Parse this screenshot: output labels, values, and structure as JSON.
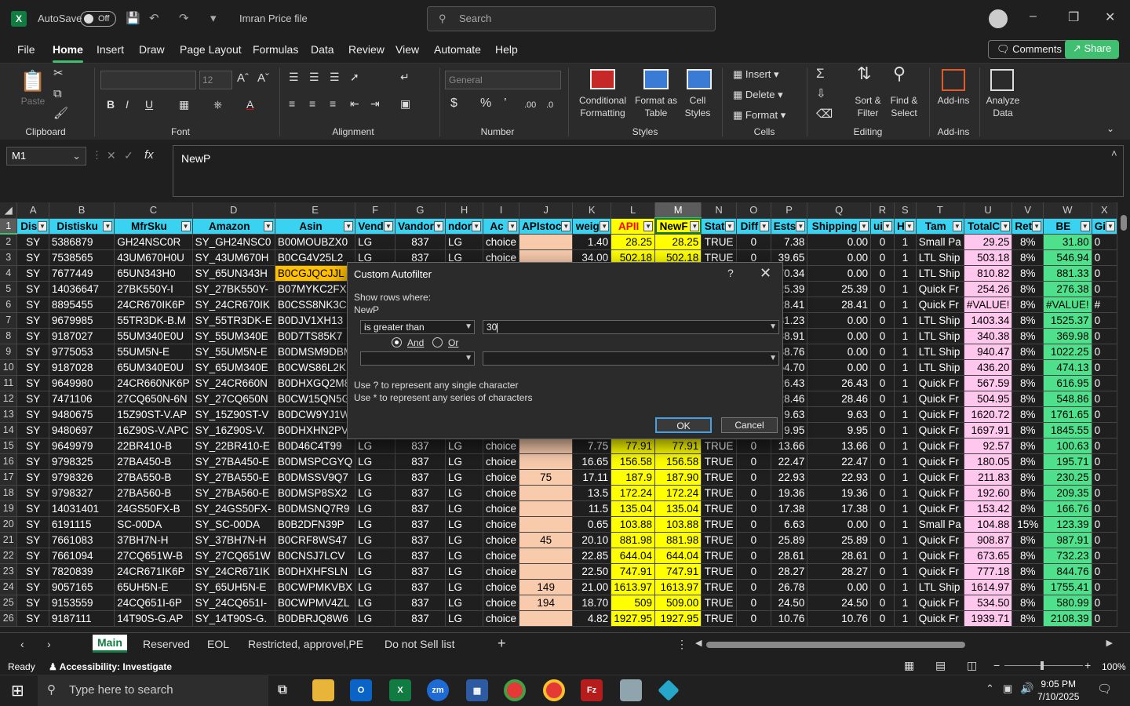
{
  "titlebar": {
    "autosave_label": "AutoSave",
    "autosave_state": "Off",
    "filename": "Imran Price file",
    "search_placeholder": "Search"
  },
  "menu": [
    "File",
    "Home",
    "Insert",
    "Draw",
    "Page Layout",
    "Formulas",
    "Data",
    "Review",
    "View",
    "Automate",
    "Help"
  ],
  "active_menu": "Home",
  "comments_label": "Comments",
  "share_label": "Share",
  "ribbon": {
    "paste": "Paste",
    "clipboard": "Clipboard",
    "font_group": "Font",
    "font_size": "12",
    "alignment": "Alignment",
    "number_format": "General",
    "number": "Number",
    "cond_fmt": "Conditional Formatting",
    "format_table": "Format as Table",
    "cell_styles": "Cell Styles",
    "styles": "Styles",
    "insert": "Insert",
    "delete": "Delete",
    "format": "Format",
    "cells": "Cells",
    "sort_filter": "Sort & Filter",
    "find_select": "Find & Select",
    "editing": "Editing",
    "addins_btn": "Add-ins",
    "addins": "Add-ins",
    "analyze": "Analyze Data"
  },
  "formula_bar": {
    "name_box": "M1",
    "content": "NewP"
  },
  "columns": [
    "A",
    "B",
    "C",
    "D",
    "E",
    "F",
    "G",
    "H",
    "I",
    "J",
    "K",
    "L",
    "M",
    "N",
    "O",
    "P",
    "Q",
    "R",
    "S",
    "T",
    "U",
    "V",
    "W",
    "X"
  ],
  "headers": [
    "Dis",
    "Distisku",
    "MfrSku",
    "Amazon",
    "Asin",
    "Vend",
    "Vandor",
    "ndor",
    "Ac",
    "APIstoc",
    "weig",
    "APII",
    "NewF",
    "Stat",
    "Diff",
    "Ests",
    "Shipping",
    "ui",
    "H",
    "Tam",
    "TotalC",
    "Ret",
    "BE",
    "Gi"
  ],
  "rows": [
    {
      "n": "2",
      "c": [
        "SY",
        "5386879",
        "GH24NSC0R",
        "SY_GH24NSC0",
        "B00MOUBZX0",
        "LG",
        "837",
        "LG",
        "choice",
        "",
        "1.40",
        "28.25",
        "28.25",
        "TRUE",
        "0",
        "7.38",
        "0.00",
        "0",
        "1",
        "Small Pa",
        "29.25",
        "8%",
        "31.80",
        "0"
      ]
    },
    {
      "n": "3",
      "c": [
        "SY",
        "7538565",
        "43UM670H0U",
        "SY_43UM670H",
        "B0CG4V25L2",
        "LG",
        "837",
        "LG",
        "choice",
        "",
        "34.00",
        "502.18",
        "502.18",
        "TRUE",
        "0",
        "39.65",
        "0.00",
        "0",
        "1",
        "LTL Ship",
        "503.18",
        "8%",
        "546.94",
        "0"
      ]
    },
    {
      "n": "4",
      "c": [
        "SY",
        "7677449",
        "65UN343H0",
        "SY_65UN343H",
        "B0CGJQCJJL",
        "LG",
        "837",
        "LG",
        "choice",
        "",
        "",
        "",
        "",
        "",
        "",
        "70.34",
        "0.00",
        "0",
        "1",
        "LTL Ship",
        "810.82",
        "8%",
        "881.33",
        "0"
      ]
    },
    {
      "n": "5",
      "c": [
        "SY",
        "14036647",
        "27BK550Y-I",
        "SY_27BK550Y-",
        "B07MYKC2FX",
        "LG",
        "837",
        "LG",
        "choice",
        "",
        "",
        "",
        "",
        "",
        "",
        "25.39",
        "25.39",
        "0",
        "1",
        "Quick Fr",
        "254.26",
        "8%",
        "276.38",
        "0"
      ]
    },
    {
      "n": "6",
      "c": [
        "SY",
        "8895455",
        "24CR670IK6P",
        "SY_24CR670IK",
        "B0CSS8NK3C",
        "LG",
        "837",
        "LG",
        "choice",
        "",
        "",
        "",
        "",
        "",
        "",
        "28.41",
        "28.41",
        "0",
        "1",
        "Quick Fr",
        "#VALUE!",
        "8%",
        "#VALUE!",
        "#"
      ]
    },
    {
      "n": "7",
      "c": [
        "SY",
        "9679985",
        "55TR3DK-B.M",
        "SY_55TR3DK-E",
        "B0DJV1XH13",
        "LG",
        "837",
        "LG",
        "choice",
        "",
        "",
        "",
        "",
        "",
        "",
        "81.23",
        "0.00",
        "0",
        "1",
        "LTL Ship",
        "1403.34",
        "8%",
        "1525.37",
        "0"
      ]
    },
    {
      "n": "8",
      "c": [
        "SY",
        "9187027",
        "55UM340E0U",
        "SY_55UM340E",
        "B0D7TS85K7",
        "LG",
        "837",
        "LG",
        "choice",
        "",
        "",
        "",
        "",
        "",
        "",
        "38.91",
        "0.00",
        "0",
        "1",
        "LTL Ship",
        "340.38",
        "8%",
        "369.98",
        "0"
      ]
    },
    {
      "n": "9",
      "c": [
        "SY",
        "9775053",
        "55UM5N-E",
        "SY_55UM5N-E",
        "B0DMSM9DBM",
        "LG",
        "837",
        "LG",
        "choice",
        "",
        "",
        "",
        "",
        "",
        "",
        "38.76",
        "0.00",
        "0",
        "1",
        "LTL Ship",
        "940.47",
        "8%",
        "1022.25",
        "0"
      ]
    },
    {
      "n": "10",
      "c": [
        "SY",
        "9187028",
        "65UM340E0U",
        "SY_65UM340E",
        "B0CWS86L2K",
        "LG",
        "837",
        "LG",
        "choice",
        "",
        "",
        "",
        "",
        "",
        "",
        "54.70",
        "0.00",
        "0",
        "1",
        "LTL Ship",
        "436.20",
        "8%",
        "474.13",
        "0"
      ]
    },
    {
      "n": "11",
      "c": [
        "SY",
        "9649980",
        "24CR660NK6P",
        "SY_24CR660N",
        "B0DHXGQ2M8",
        "LG",
        "837",
        "LG",
        "choice",
        "",
        "",
        "",
        "",
        "",
        "",
        "26.43",
        "26.43",
        "0",
        "1",
        "Quick Fr",
        "567.59",
        "8%",
        "616.95",
        "0"
      ]
    },
    {
      "n": "12",
      "c": [
        "SY",
        "7471106",
        "27CQ650N-6N",
        "SY_27CQ650N",
        "B0CW15QN5G",
        "LG",
        "837",
        "LG",
        "choice",
        "",
        "",
        "",
        "",
        "",
        "",
        "28.46",
        "28.46",
        "0",
        "1",
        "Quick Fr",
        "504.95",
        "8%",
        "548.86",
        "0"
      ]
    },
    {
      "n": "13",
      "c": [
        "SY",
        "9480675",
        "15Z90ST-V.AP",
        "SY_15Z90ST-V",
        "B0DCW9YJ1W",
        "LG",
        "837",
        "LG",
        "choice",
        "",
        "",
        "",
        "",
        "",
        "",
        "9.63",
        "9.63",
        "0",
        "1",
        "Quick Fr",
        "1620.72",
        "8%",
        "1761.65",
        "0"
      ]
    },
    {
      "n": "14",
      "c": [
        "SY",
        "9480697",
        "16Z90S-V.APC",
        "SY_16Z90S-V.",
        "B0DHXHN2PV",
        "LG",
        "837",
        "LG",
        "choice",
        "",
        "",
        "",
        "",
        "",
        "",
        "9.95",
        "9.95",
        "0",
        "1",
        "Quick Fr",
        "1697.91",
        "8%",
        "1845.55",
        "0"
      ]
    },
    {
      "n": "15",
      "c": [
        "SY",
        "9649979",
        "22BR410-B",
        "SY_22BR410-E",
        "B0D46C4T99",
        "LG",
        "837",
        "LG",
        "choice",
        "",
        "7.75",
        "77.91",
        "77.91",
        "TRUE",
        "0",
        "13.66",
        "13.66",
        "0",
        "1",
        "Quick Fr",
        "92.57",
        "8%",
        "100.63",
        "0"
      ]
    },
    {
      "n": "16",
      "c": [
        "SY",
        "9798325",
        "27BA450-B",
        "SY_27BA450-E",
        "B0DMSPCGYQ",
        "LG",
        "837",
        "LG",
        "choice",
        "",
        "16.65",
        "156.58",
        "156.58",
        "TRUE",
        "0",
        "22.47",
        "22.47",
        "0",
        "1",
        "Quick Fr",
        "180.05",
        "8%",
        "195.71",
        "0"
      ]
    },
    {
      "n": "17",
      "c": [
        "SY",
        "9798326",
        "27BA550-B",
        "SY_27BA550-E",
        "B0DMSSV9Q7",
        "LG",
        "837",
        "LG",
        "choice",
        "75",
        "17.11",
        "187.9",
        "187.90",
        "TRUE",
        "0",
        "22.93",
        "22.93",
        "0",
        "1",
        "Quick Fr",
        "211.83",
        "8%",
        "230.25",
        "0"
      ]
    },
    {
      "n": "18",
      "c": [
        "SY",
        "9798327",
        "27BA560-B",
        "SY_27BA560-E",
        "B0DMSP8SX2",
        "LG",
        "837",
        "LG",
        "choice",
        "",
        "13.5",
        "172.24",
        "172.24",
        "TRUE",
        "0",
        "19.36",
        "19.36",
        "0",
        "1",
        "Quick Fr",
        "192.60",
        "8%",
        "209.35",
        "0"
      ]
    },
    {
      "n": "19",
      "c": [
        "SY",
        "14031401",
        "24GS50FX-B",
        "SY_24GS50FX-",
        "B0DMSNQ7R9",
        "LG",
        "837",
        "LG",
        "choice",
        "",
        "11.5",
        "135.04",
        "135.04",
        "TRUE",
        "0",
        "17.38",
        "17.38",
        "0",
        "1",
        "Quick Fr",
        "153.42",
        "8%",
        "166.76",
        "0"
      ]
    },
    {
      "n": "20",
      "c": [
        "SY",
        "6191115",
        "SC-00DA",
        "SY_SC-00DA",
        "B0B2DFN39P",
        "LG",
        "837",
        "LG",
        "choice",
        "",
        "0.65",
        "103.88",
        "103.88",
        "TRUE",
        "0",
        "6.63",
        "0.00",
        "0",
        "1",
        "Small Pa",
        "104.88",
        "15%",
        "123.39",
        "0"
      ]
    },
    {
      "n": "21",
      "c": [
        "SY",
        "7661083",
        "37BH7N-H",
        "SY_37BH7N-H",
        "B0CRF8WS47",
        "LG",
        "837",
        "LG",
        "choice",
        "45",
        "20.10",
        "881.98",
        "881.98",
        "TRUE",
        "0",
        "25.89",
        "25.89",
        "0",
        "1",
        "Quick Fr",
        "908.87",
        "8%",
        "987.91",
        "0"
      ]
    },
    {
      "n": "22",
      "c": [
        "SY",
        "7661094",
        "27CQ651W-B",
        "SY_27CQ651W",
        "B0CNSJ7LCV",
        "LG",
        "837",
        "LG",
        "choice",
        "",
        "22.85",
        "644.04",
        "644.04",
        "TRUE",
        "0",
        "28.61",
        "28.61",
        "0",
        "1",
        "Quick Fr",
        "673.65",
        "8%",
        "732.23",
        "0"
      ]
    },
    {
      "n": "23",
      "c": [
        "SY",
        "7820839",
        "24CR671IK6P",
        "SY_24CR671IK",
        "B0DHXHFSLN",
        "LG",
        "837",
        "LG",
        "choice",
        "",
        "22.50",
        "747.91",
        "747.91",
        "TRUE",
        "0",
        "28.27",
        "28.27",
        "0",
        "1",
        "Quick Fr",
        "777.18",
        "8%",
        "844.76",
        "0"
      ]
    },
    {
      "n": "24",
      "c": [
        "SY",
        "9057165",
        "65UH5N-E",
        "SY_65UH5N-E",
        "B0CWPMKVBX",
        "LG",
        "837",
        "LG",
        "choice",
        "149",
        "21.00",
        "1613.97",
        "1613.97",
        "TRUE",
        "0",
        "26.78",
        "0.00",
        "0",
        "1",
        "LTL Ship",
        "1614.97",
        "8%",
        "1755.41",
        "0"
      ]
    },
    {
      "n": "25",
      "c": [
        "SY",
        "9153559",
        "24CQ651I-6P",
        "SY_24CQ651I-",
        "B0CWPMV4ZL",
        "LG",
        "837",
        "LG",
        "choice",
        "194",
        "18.70",
        "509",
        "509.00",
        "TRUE",
        "0",
        "24.50",
        "24.50",
        "0",
        "1",
        "Quick Fr",
        "534.50",
        "8%",
        "580.99",
        "0"
      ]
    },
    {
      "n": "26",
      "c": [
        "SY",
        "9187111",
        "14T90S-G.AP",
        "SY_14T90S-G.",
        "B0DBRJQ8W6",
        "LG",
        "837",
        "LG",
        "choice",
        "",
        "4.82",
        "1927.95",
        "1927.95",
        "TRUE",
        "0",
        "10.76",
        "10.76",
        "0",
        "1",
        "Quick Fr",
        "1939.71",
        "8%",
        "2108.39",
        "0"
      ]
    }
  ],
  "dialog": {
    "title": "Custom Autofilter",
    "help": "?",
    "show_rows": "Show rows where:",
    "field": "NewP",
    "operator1": "is greater than",
    "value1": "30",
    "and_label": "And",
    "or_label": "Or",
    "operator2": "",
    "value2": "",
    "hint1": "Use ? to represent any single character",
    "hint2": "Use * to represent any series of characters",
    "ok": "OK",
    "cancel": "Cancel"
  },
  "sheet_tabs": [
    "Main",
    "Reserved",
    "EOL",
    "Restricted, approvel,PE",
    "Do not Sell list"
  ],
  "status": {
    "ready": "Ready",
    "accessibility": "Accessibility: Investigate",
    "zoom": "100%"
  },
  "taskbar": {
    "search_placeholder": "Type here to search",
    "time": "9:05 PM",
    "date": "7/10/2025"
  },
  "colors": {
    "header_cyan": "#39d2f0",
    "yellow": "#ffff00",
    "peach": "#f8cbad",
    "pink": "#ffc7ee",
    "green": "#4ee08a",
    "excel_green": "#107c41"
  }
}
